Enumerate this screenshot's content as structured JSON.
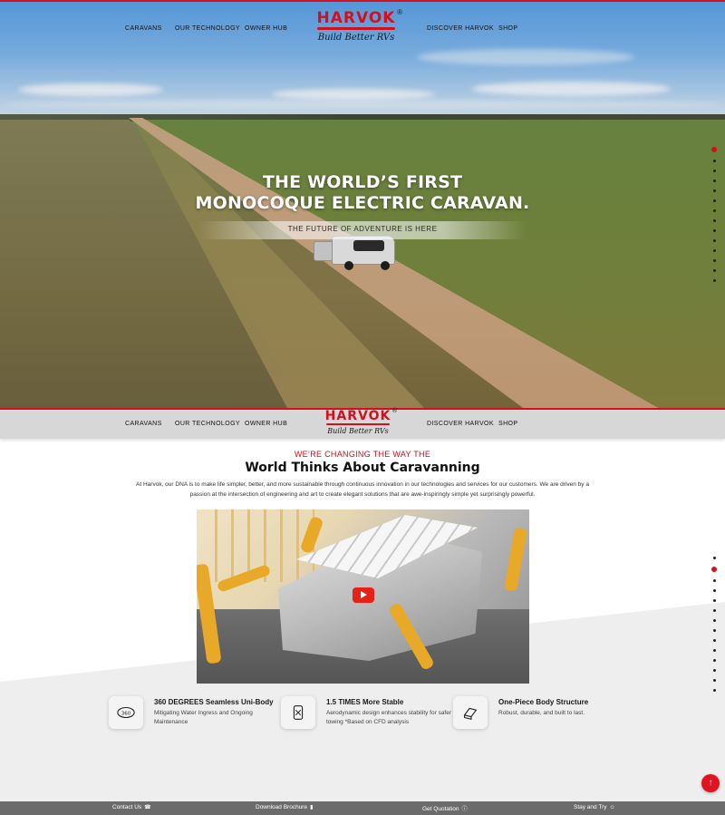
{
  "brand": {
    "name": "HARVOK",
    "registered_mark": "®",
    "slogan": "Build Better RVs",
    "accent_color": "#d4101f"
  },
  "nav": {
    "left": [
      "CARAVANS",
      "OUR TECHNOLOGY",
      "OWNER HUB"
    ],
    "right": [
      "DISCOVER HARVOK",
      "SHOP"
    ]
  },
  "hero": {
    "headline_line1": "THE WORLD’S FIRST",
    "headline_line2": "MONOCOQUE ELECTRIC CARAVAN.",
    "tagline": "THE FUTURE OF ADVENTURE IS HERE"
  },
  "about": {
    "kicker": "WE’RE CHANGING THE WAY THE",
    "title": "World Thinks About Caravanning",
    "body": "At Harvok, our DNA is to make life simpler, better, and more sustainable through continuous innovation in our technologies and services for our customers. We are driven by a passion at the intersection of engineering and art to create elegant solutions that are awe-inspiringly simple yet surprisingly powerful.",
    "video_play_icon": "youtube-play-icon"
  },
  "features": [
    {
      "icon": "360-degree-icon",
      "title": "360 DEGREES Seamless Uni-Body",
      "desc": "Mitigating Water Ingress and Ongoing Maintenance"
    },
    {
      "icon": "stability-icon",
      "title": "1.5 TIMES More Stable",
      "desc": "Aerodynamic design enhances stability for safer towing *Based on CFD analysis"
    },
    {
      "icon": "one-piece-body-icon",
      "title": "One-Piece Body Structure",
      "desc": "Robust, durable, and built to last."
    }
  ],
  "back_to_top": "↑",
  "footer": {
    "contact": "Contact Us",
    "brochure": "Download Brochure",
    "quotation": "Get Quotation",
    "stay": "Stay and Try"
  }
}
